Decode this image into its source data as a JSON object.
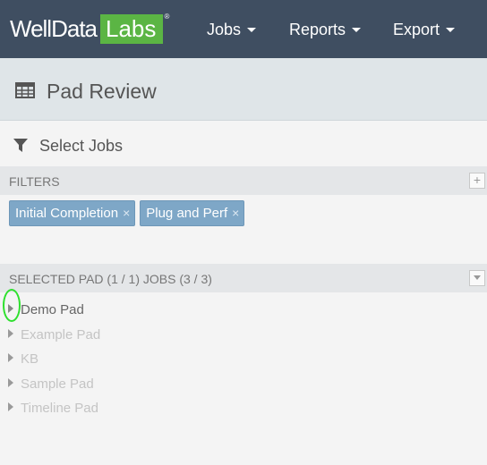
{
  "navbar": {
    "logo": {
      "text_main": "WellData",
      "text_accent": "Labs",
      "registered": "®"
    },
    "items": [
      {
        "label": "Jobs"
      },
      {
        "label": "Reports"
      },
      {
        "label": "Export"
      }
    ]
  },
  "page_header": {
    "icon": "table-icon",
    "title": "Pad Review"
  },
  "select_jobs": {
    "icon": "filter-icon",
    "title": "Select Jobs"
  },
  "filters": {
    "label": "FILTERS",
    "add_button": "+",
    "chips": [
      {
        "label": "Initial Completion",
        "remove": "×"
      },
      {
        "label": "Plug and Perf",
        "remove": "×"
      }
    ]
  },
  "selected": {
    "label": "SELECTED PAD (1 / 1) JOBS (3 / 3)",
    "collapse_icon": "caret-down-icon",
    "pads": [
      {
        "label": "Demo Pad",
        "active": true
      },
      {
        "label": "Example Pad",
        "active": false
      },
      {
        "label": "KB",
        "active": false
      },
      {
        "label": "Sample Pad",
        "active": false
      },
      {
        "label": "Timeline Pad",
        "active": false
      }
    ]
  },
  "colors": {
    "navbar": "#3f4e61",
    "logo_accent": "#5bb544",
    "chip": "#7ea7c7",
    "highlight": "#2ee02e"
  }
}
